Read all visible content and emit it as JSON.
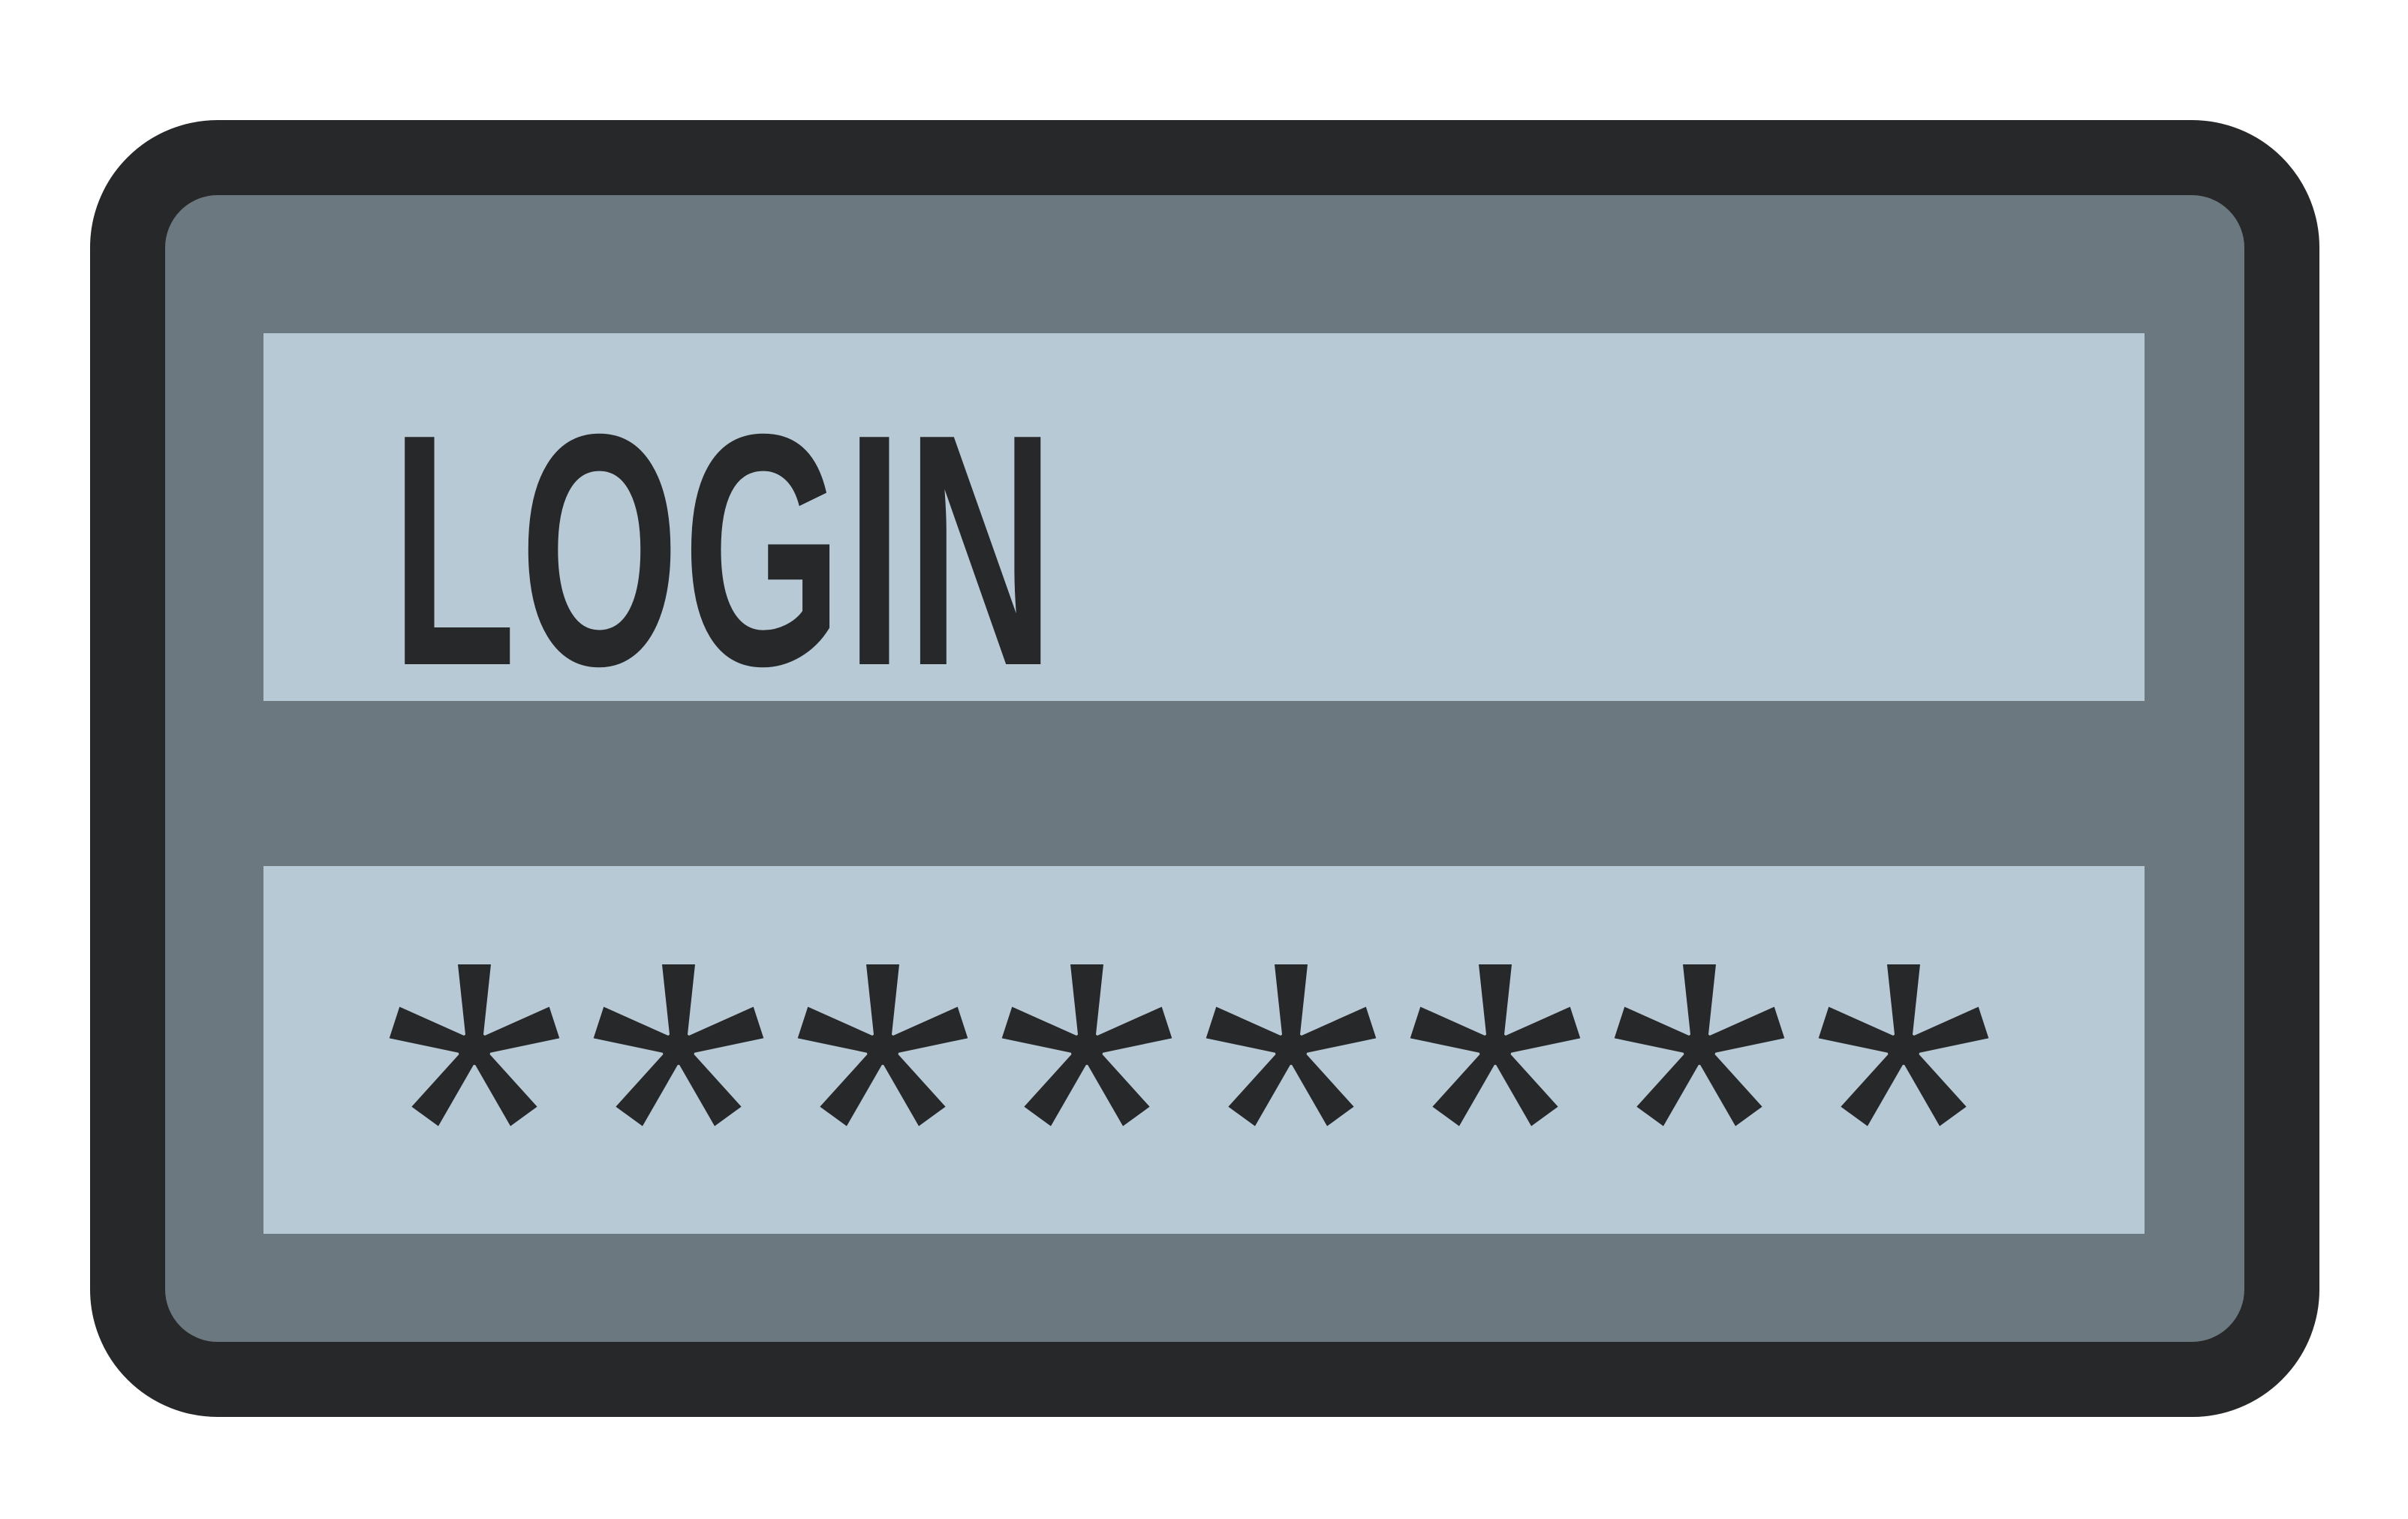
{
  "login_form": {
    "username_field": {
      "value": "LOGIN"
    },
    "password_field": {
      "masked_value": "********",
      "mask_glyph": "asterisk-icon",
      "mask_count": 8
    }
  },
  "colors": {
    "frame_border": "#27282a",
    "frame_fill": "#6b7880",
    "field_fill": "#b7c9d5",
    "text": "#27282a",
    "background": "#ffffff"
  }
}
